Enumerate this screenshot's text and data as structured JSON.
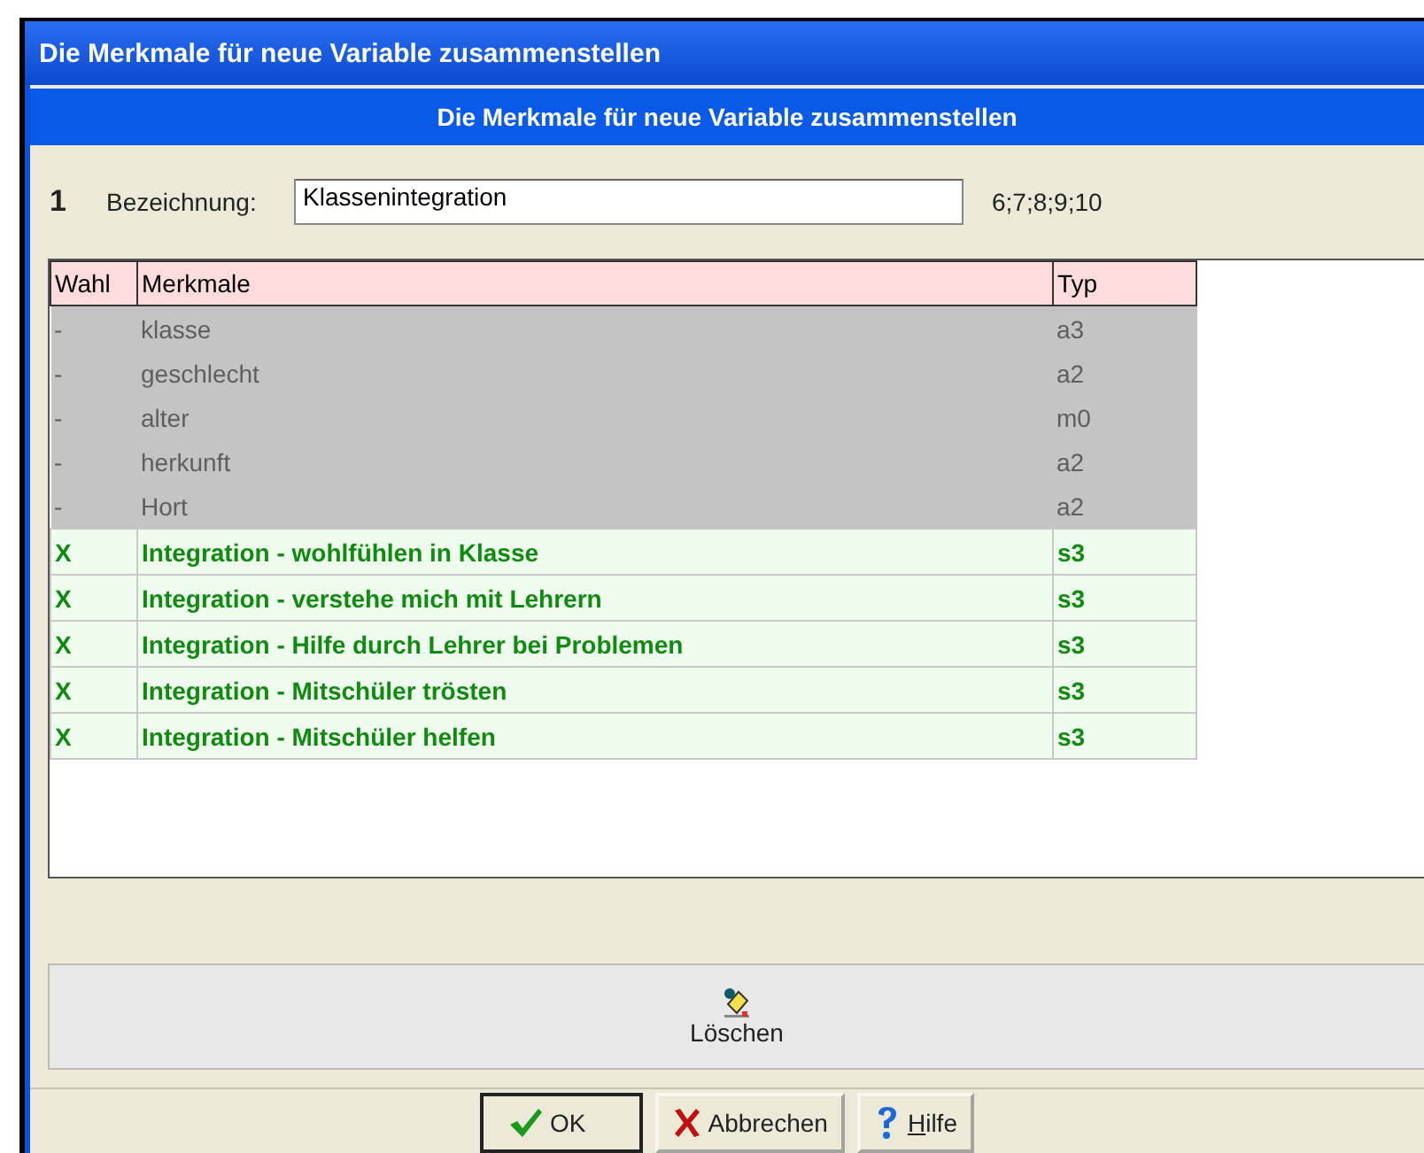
{
  "window": {
    "title": "Die Merkmale für neue Variable zusammenstellen"
  },
  "header": "Die Merkmale für neue Variable zusammenstellen",
  "number": "1",
  "name_label": "Bezeichnung:",
  "name_field": {
    "value": "Klassenintegration"
  },
  "codes": "6;7;8;9;10",
  "table": {
    "columns": [
      "Wahl",
      "Merkmale",
      "Typ"
    ],
    "rows": [
      {
        "choice": "-",
        "name": "klasse",
        "type": "a3",
        "selected": false
      },
      {
        "choice": "-",
        "name": "geschlecht",
        "type": "a2",
        "selected": false
      },
      {
        "choice": "-",
        "name": "alter",
        "type": "m0",
        "selected": false
      },
      {
        "choice": "-",
        "name": "herkunft",
        "type": "a2",
        "selected": false
      },
      {
        "choice": "-",
        "name": "Hort",
        "type": "a2",
        "selected": false
      },
      {
        "choice": "X",
        "name": "Integration - wohlfühlen in Klasse",
        "type": "s3",
        "selected": true
      },
      {
        "choice": "X",
        "name": "Integration - verstehe mich mit Lehrern",
        "type": "s3",
        "selected": true
      },
      {
        "choice": "X",
        "name": "Integration - Hilfe durch Lehrer bei Problemen",
        "type": "s3",
        "selected": true
      },
      {
        "choice": "X",
        "name": "Integration - Mitschüler trösten",
        "type": "s3",
        "selected": true
      },
      {
        "choice": "X",
        "name": "Integration - Mitschüler helfen",
        "type": "s3",
        "selected": true
      }
    ]
  },
  "delete_button": {
    "label": "Löschen"
  },
  "buttons": [
    {
      "kind": "ok",
      "label": "OK",
      "mnemonic_first": false
    },
    {
      "kind": "cancel",
      "label": "Abbrechen",
      "mnemonic_first": false
    },
    {
      "kind": "help",
      "label": "Hilfe",
      "mnemonic_first": true
    }
  ]
}
